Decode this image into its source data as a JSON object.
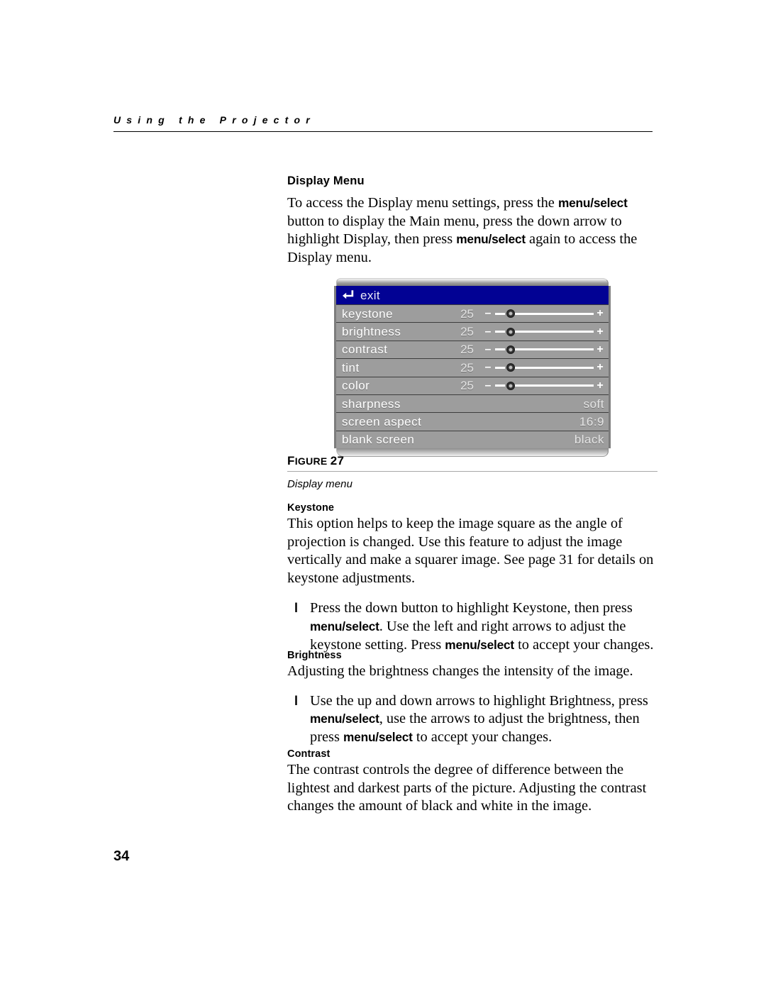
{
  "header": {
    "running_title": "Using the Projector"
  },
  "section": {
    "title": "Display Menu",
    "intro_part1": "To access the Display menu settings, press the ",
    "intro_bold1": "menu/select",
    "intro_part2": " button to display the Main menu, press the down arrow to highlight Display, then press ",
    "intro_bold2": "menu/select",
    "intro_part3": " again to access the Display menu."
  },
  "osd_menu": {
    "exit_label": "exit",
    "exit_icon": "back-arrow-icon",
    "title_bar_color": "#020294",
    "row_color": "#9d9d9d",
    "rows": [
      {
        "label": "keystone",
        "value": "25",
        "type": "slider"
      },
      {
        "label": "brightness",
        "value": "25",
        "type": "slider"
      },
      {
        "label": "contrast",
        "value": "25",
        "type": "slider"
      },
      {
        "label": "tint",
        "value": "25",
        "type": "slider"
      },
      {
        "label": "color",
        "value": "25",
        "type": "slider"
      },
      {
        "label": "sharpness",
        "value": "soft",
        "type": "value"
      },
      {
        "label": "screen aspect",
        "value": "16:9",
        "type": "value"
      },
      {
        "label": "blank screen",
        "value": "black",
        "type": "value"
      }
    ],
    "slider_minus": "–",
    "slider_plus": "+"
  },
  "figure": {
    "number_prefix": "F",
    "number_rest": "IGURE ",
    "number": "27",
    "caption": "Display menu"
  },
  "keystone": {
    "heading": "Keystone",
    "body": "This option helps to keep the image square as the angle of projection is changed. Use this feature to adjust the image vertically and make a squarer image. See page 31 for details on keystone adjustments.",
    "step_marker": "l",
    "step_part1": "Press the down button to highlight Keystone, then press ",
    "step_bold1": "menu/select",
    "step_part2": ". Use the left and right arrows to adjust the keystone setting. Press ",
    "step_bold2": "menu/select",
    "step_part3": " to accept your changes."
  },
  "brightness": {
    "heading": "Brightness",
    "body": "Adjusting the brightness changes the intensity of the image.",
    "step_marker": "l",
    "step_part1": "Use the up and down arrows to highlight Brightness, press ",
    "step_bold1": "menu/select",
    "step_part2": ", use the arrows to adjust the brightness, then press ",
    "step_bold2": "menu/select",
    "step_part3": " to accept your changes."
  },
  "contrast": {
    "heading": "Contrast",
    "body": "The contrast controls the degree of difference between the lightest and darkest parts of the picture. Adjusting the contrast changes the amount of black and white in the image."
  },
  "folio": {
    "page_number": "34"
  }
}
